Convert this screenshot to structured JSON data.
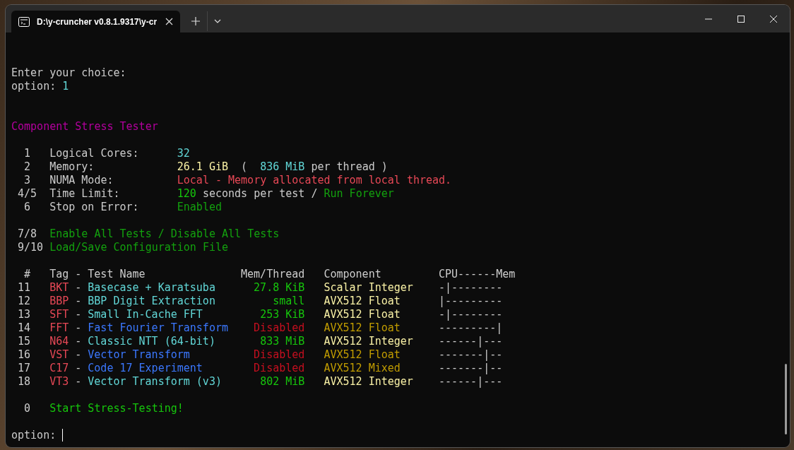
{
  "window": {
    "title": "D:\\y-cruncher v0.8.1.9317\\y-cr"
  },
  "terminal": {
    "prompt": "Enter your choice:",
    "choice": {
      "label": "option:",
      "value": "1"
    },
    "heading": "Component Stress Tester",
    "settings": [
      {
        "key": "1",
        "label": "Logical Cores:",
        "value": [
          {
            "text": "32",
            "color": "#61d6d6"
          }
        ]
      },
      {
        "key": "2",
        "label": "Memory:",
        "value": [
          {
            "text": "26.1 GiB",
            "color": "#f9f1a5"
          },
          {
            "text": "  (  ",
            "color": "#cccccc"
          },
          {
            "text": "836 MiB",
            "color": "#61d6d6"
          },
          {
            "text": " per thread )",
            "color": "#cccccc"
          }
        ]
      },
      {
        "key": "3",
        "label": "NUMA Mode:",
        "value": [
          {
            "text": "Local - Memory allocated from local thread.",
            "color": "#e74856"
          }
        ]
      },
      {
        "key": "4/5",
        "label": "Time Limit:",
        "value": [
          {
            "text": "120",
            "color": "#16c60c"
          },
          {
            "text": " seconds per test / ",
            "color": "#cccccc"
          },
          {
            "text": "Run Forever",
            "color": "#13a10e"
          }
        ]
      },
      {
        "key": "6",
        "label": "Stop on Error:",
        "value": [
          {
            "text": "Enabled",
            "color": "#13a10e"
          }
        ]
      }
    ],
    "actions": [
      {
        "key": "7/8",
        "label": "Enable All Tests / Disable All Tests"
      },
      {
        "key": "9/10",
        "label": "Load/Save Configuration File"
      }
    ],
    "table": {
      "header": {
        "number": "#",
        "tag": "Tag",
        "separator": "-",
        "name": "Test Name",
        "memory": "Mem/Thread",
        "component": "Component",
        "balance": "CPU------Mem"
      },
      "rows": [
        {
          "number": "11",
          "tag": "BKT",
          "separator": "-",
          "name": "Basecase + Karatsuba",
          "memory": "27.8 KiB",
          "component": "Scalar Integer",
          "balance": "-|--------",
          "enabled": true
        },
        {
          "number": "12",
          "tag": "BBP",
          "separator": "-",
          "name": "BBP Digit Extraction",
          "memory": "small",
          "component": "AVX512 Float",
          "balance": "|---------",
          "enabled": true
        },
        {
          "number": "13",
          "tag": "SFT",
          "separator": "-",
          "name": "Small In-Cache FFT",
          "memory": "253 KiB",
          "component": "AVX512 Float",
          "balance": "-|--------",
          "enabled": true
        },
        {
          "number": "14",
          "tag": "FFT",
          "separator": "-",
          "name": "Fast Fourier Transform",
          "memory": "Disabled",
          "component": "AVX512 Float",
          "balance": "---------|",
          "enabled": false
        },
        {
          "number": "15",
          "tag": "N64",
          "separator": "-",
          "name": "Classic NTT (64-bit)",
          "memory": "833 MiB",
          "component": "AVX512 Integer",
          "balance": "------|---",
          "enabled": true
        },
        {
          "number": "16",
          "tag": "VST",
          "separator": "-",
          "name": "Vector Transform",
          "memory": "Disabled",
          "component": "AVX512 Float",
          "balance": "-------|--",
          "enabled": false
        },
        {
          "number": "17",
          "tag": "C17",
          "separator": "-",
          "name": "Code 17 Experiment",
          "memory": "Disabled",
          "component": "AVX512 Mixed",
          "balance": "-------|--",
          "enabled": false
        },
        {
          "number": "18",
          "tag": "VT3",
          "separator": "-",
          "name": "Vector Transform (v3)",
          "memory": "802 MiB",
          "component": "AVX512 Integer",
          "balance": "------|---",
          "enabled": true
        }
      ]
    },
    "start": {
      "key": "0",
      "label": "Start Stress-Testing!"
    },
    "input": {
      "label": "option:"
    }
  }
}
